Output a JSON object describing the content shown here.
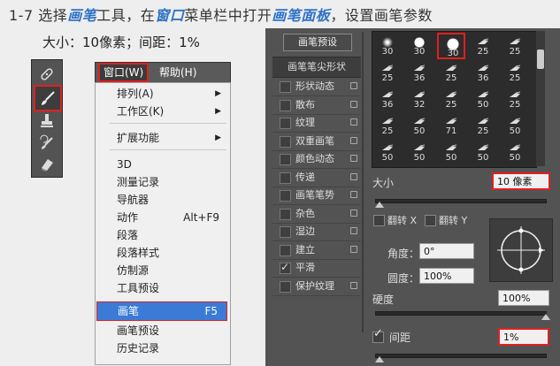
{
  "heading": {
    "prefix": "1-7 选择",
    "w1": "画笔",
    "t1": "工具，在",
    "w2": "窗口",
    "t2": "菜单栏中打开",
    "w3": "画笔面板",
    "t3": "，设置画笔参数"
  },
  "subline": "大小：10像素；间距：1%",
  "menubar": {
    "window": "窗口(W)",
    "help": "帮助(H)"
  },
  "menu": [
    {
      "label": "排列(A)",
      "submenu": true
    },
    {
      "label": "工作区(K)",
      "submenu": true
    },
    {
      "label": "扩展功能",
      "submenu": true
    },
    {
      "label": "3D"
    },
    {
      "label": "测量记录"
    },
    {
      "label": "导航器"
    },
    {
      "label": "动作",
      "shortcut": "Alt+F9"
    },
    {
      "label": "段落"
    },
    {
      "label": "段落样式"
    },
    {
      "label": "仿制源"
    },
    {
      "label": "工具预设"
    },
    {
      "label": "画笔",
      "shortcut": "F5"
    },
    {
      "label": "画笔预设"
    },
    {
      "label": "历史记录"
    }
  ],
  "panel": {
    "preset_button": "画笔预设",
    "tip_shape": "画笔笔尖形状",
    "options": [
      {
        "label": "形状动态",
        "checked": false
      },
      {
        "label": "散布",
        "checked": false
      },
      {
        "label": "纹理",
        "checked": false
      },
      {
        "label": "双重画笔",
        "checked": false
      },
      {
        "label": "颜色动态",
        "checked": false
      },
      {
        "label": "传递",
        "checked": false
      },
      {
        "label": "画笔笔势",
        "checked": false
      },
      {
        "label": "杂色",
        "checked": false
      },
      {
        "label": "湿边",
        "checked": false
      },
      {
        "label": "建立",
        "checked": false
      },
      {
        "label": "平滑",
        "checked": true
      },
      {
        "label": "保护纹理",
        "checked": false
      }
    ],
    "brushes": [
      30,
      30,
      30,
      25,
      25,
      25,
      36,
      25,
      36,
      25,
      36,
      32,
      25,
      50,
      25,
      25,
      50,
      71,
      25,
      50,
      50,
      50,
      50,
      50,
      50
    ],
    "selected_brush_index": 2,
    "size_label": "大小",
    "size_value": "10 像素",
    "flip_x": "翻转 X",
    "flip_y": "翻转 Y",
    "angle_label": "角度：",
    "angle_value": "0°",
    "roundness_label": "圆度：",
    "roundness_value": "100%",
    "hardness_label": "硬度",
    "hardness_value": "100%",
    "spacing_label": "间距",
    "spacing_value": "1%",
    "spacing_checked": true
  }
}
